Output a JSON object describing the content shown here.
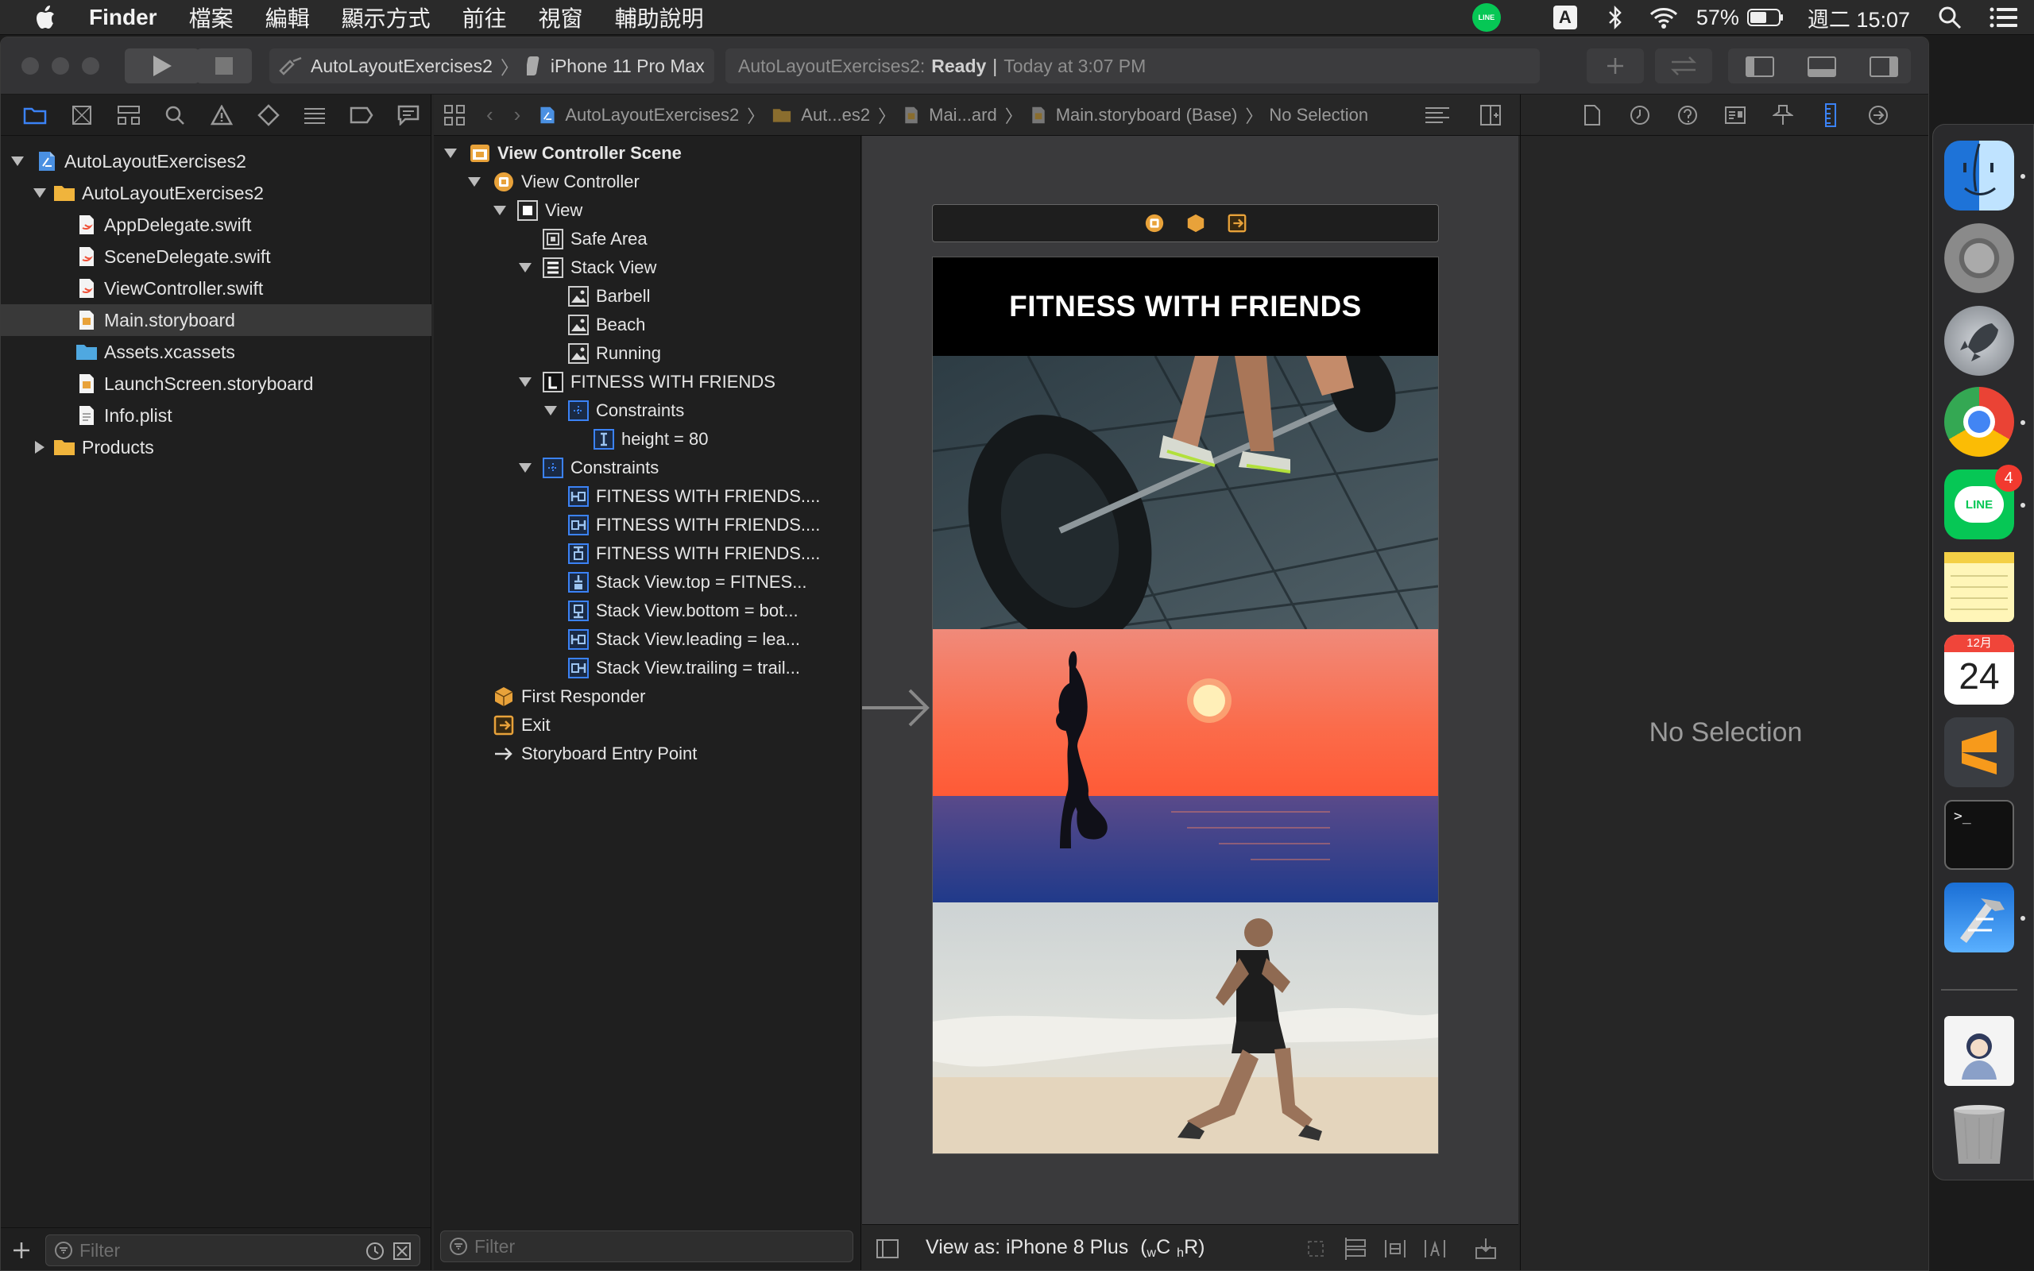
{
  "menubar": {
    "app_name": "Finder",
    "items": [
      "檔案",
      "編輯",
      "顯示方式",
      "前往",
      "視窗",
      "輔助說明"
    ],
    "line_badge": "LINE",
    "input_source": "A",
    "battery": "57%",
    "clock": "週二 15:07"
  },
  "toolbar": {
    "scheme": "AutoLayoutExercises2",
    "device": "iPhone 11 Pro Max",
    "activity_project": "AutoLayoutExercises2:",
    "activity_status": "Ready",
    "activity_sep": "|",
    "activity_time": "Today at 3:07 PM"
  },
  "navigator": {
    "rows": [
      {
        "label": "AutoLayoutExercises2",
        "kind": "project"
      },
      {
        "label": "AutoLayoutExercises2",
        "kind": "folder"
      },
      {
        "label": "AppDelegate.swift",
        "kind": "swift"
      },
      {
        "label": "SceneDelegate.swift",
        "kind": "swift"
      },
      {
        "label": "ViewController.swift",
        "kind": "swift"
      },
      {
        "label": "Main.storyboard",
        "kind": "storyboard"
      },
      {
        "label": "Assets.xcassets",
        "kind": "assets"
      },
      {
        "label": "LaunchScreen.storyboard",
        "kind": "storyboard"
      },
      {
        "label": "Info.plist",
        "kind": "plist"
      },
      {
        "label": "Products",
        "kind": "folder"
      }
    ],
    "filter_placeholder": "Filter"
  },
  "jumpbar": {
    "crumbs": [
      "AutoLayoutExercises2",
      "Aut...es2",
      "Mai...ard",
      "Main.storyboard (Base)",
      "No Selection"
    ]
  },
  "outline": {
    "rows": [
      {
        "label": "View Controller Scene",
        "bold": true
      },
      {
        "label": "View Controller"
      },
      {
        "label": "View"
      },
      {
        "label": "Safe Area"
      },
      {
        "label": "Stack View"
      },
      {
        "label": "Barbell"
      },
      {
        "label": "Beach"
      },
      {
        "label": "Running"
      },
      {
        "label": "FITNESS WITH FRIENDS"
      },
      {
        "label": "Constraints"
      },
      {
        "label": "height = 80"
      },
      {
        "label": "Constraints"
      },
      {
        "label": "FITNESS WITH FRIENDS...."
      },
      {
        "label": "FITNESS WITH FRIENDS...."
      },
      {
        "label": "FITNESS WITH FRIENDS...."
      },
      {
        "label": "Stack View.top = FITNES..."
      },
      {
        "label": "Stack View.bottom = bot..."
      },
      {
        "label": "Stack View.leading = lea..."
      },
      {
        "label": "Stack View.trailing = trail..."
      },
      {
        "label": "First Responder"
      },
      {
        "label": "Exit"
      },
      {
        "label": "Storyboard Entry Point"
      }
    ],
    "filter_placeholder": "Filter"
  },
  "canvas": {
    "header_title": "FITNESS WITH FRIENDS",
    "view_as": "View as: iPhone 8 Plus",
    "size_class_w": "w",
    "size_class_wval": "C",
    "size_class_h": "h",
    "size_class_hval": "R)",
    "view_as_open": "("
  },
  "inspector": {
    "empty_label": "No Selection"
  },
  "dock": {
    "line_badge_count": "4",
    "calendar_month": "12月",
    "calendar_day": "24"
  },
  "colors": {
    "accent": "#3b82f6",
    "selection": "#393939",
    "folder": "#f0b43c",
    "storyboard_icon": "#e8a23a"
  }
}
